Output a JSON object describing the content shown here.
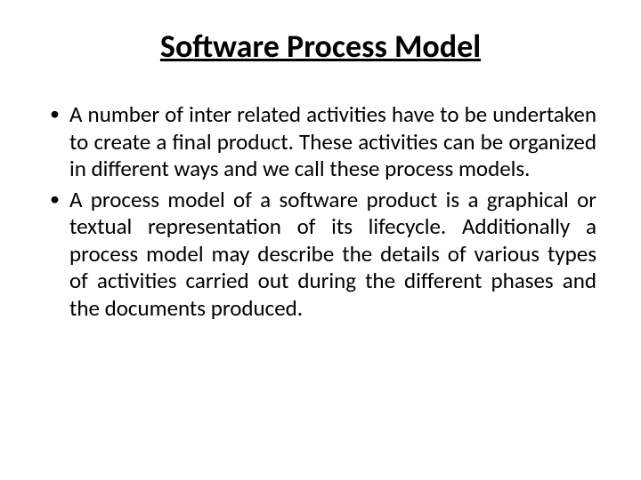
{
  "title": "Software Process Model",
  "bullets": [
    "A number of inter related activities have to be undertaken to create a final product. These activities can be organized in different ways and we call these process models.",
    "A process model of a software product is a graphical or textual representation of its lifecycle. Additionally a process model may describe the details of various types of activities carried out during the different phases and the documents produced."
  ]
}
